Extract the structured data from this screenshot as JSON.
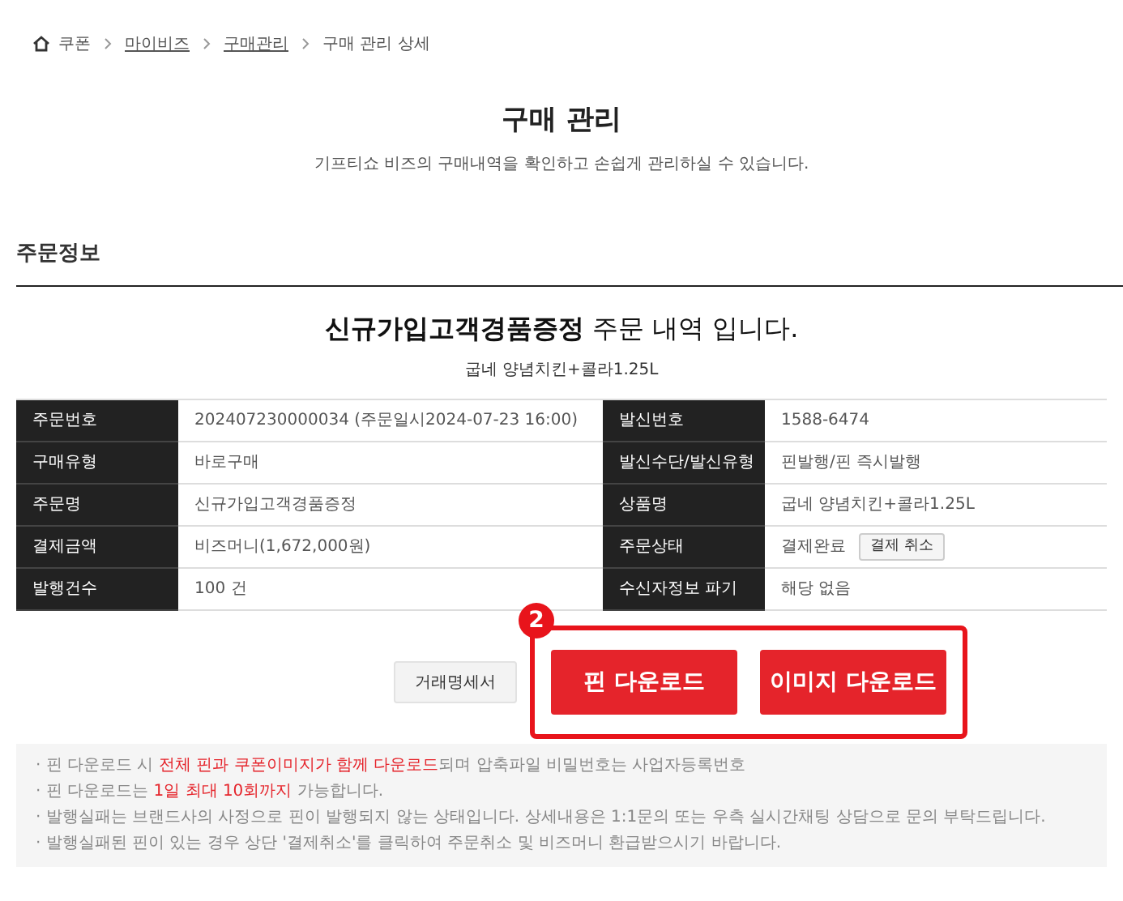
{
  "breadcrumb": [
    {
      "label": "쿠폰",
      "kind": "home"
    },
    {
      "label": "마이비즈",
      "kind": "link"
    },
    {
      "label": "구매관리",
      "kind": "link"
    },
    {
      "label": "구매 관리 상세",
      "kind": "current"
    }
  ],
  "page": {
    "title": "구매 관리",
    "subtitle": "기프티쇼 비즈의 구매내역을 확인하고 손쉽게 관리하실 수 있습니다."
  },
  "section": {
    "title": "주문정보"
  },
  "order": {
    "heading": "**신규가입고객경품증정** 주문 내역 입니다.",
    "product": "굽네 양념치킨+콜라1.25L"
  },
  "fields": [
    {
      "label": "주문번호",
      "value": "202407230000034 (주문일시2024-07-23 16:00)",
      "kind": "text"
    },
    {
      "label": "발신번호",
      "value": "1588-6474",
      "kind": "text"
    },
    {
      "label": "구매유형",
      "value": "바로구매",
      "kind": "text"
    },
    {
      "label": "발신수단/발신유형",
      "value": "핀발행/핀 즉시발행",
      "kind": "text"
    },
    {
      "label": "주문명",
      "value": "신규가입고객경품증정",
      "kind": "text"
    },
    {
      "label": "상품명",
      "value": "굽네 양념치킨+콜라1.25L",
      "kind": "text"
    },
    {
      "label": "결제금액",
      "value": "비즈머니(1,672,000원)",
      "kind": "text"
    },
    {
      "label": "주문상태",
      "value": "결제완료",
      "kind": "action",
      "action": "결제 취소"
    },
    {
      "label": "발행건수",
      "value": "100 건",
      "kind": "text"
    },
    {
      "label": "수신자정보 파기",
      "value": "해당 없음",
      "kind": "text"
    }
  ],
  "buttons": [
    {
      "label": "거래명세서",
      "kind": "secondary"
    },
    {
      "label": "핀 다운로드",
      "kind": "primary"
    },
    {
      "label": "이미지 다운로드",
      "kind": "primary"
    }
  ],
  "annotation": {
    "number": "2"
  },
  "notes": [
    "· 핀 다운로드 시 **전체 핀과 쿠폰이미지가 함께 다운로드**되며 압축파일 비밀번호는 사업자등록번호",
    "· 핀 다운로드는 **1일 최대 10회까지** 가능합니다.",
    "· 발행실패는 브랜드사의 사정으로 핀이 발행되지 않는 상태입니다. 상세내용은 1:1문의 또는 우측 실시간채팅 상담으로 문의 부탁드립니다.",
    "· 발행실패된 핀이 있는 경우 상단 '결제취소'를 클릭하여 주문취소 및 비즈머니 환급받으시기 바랍니다."
  ]
}
